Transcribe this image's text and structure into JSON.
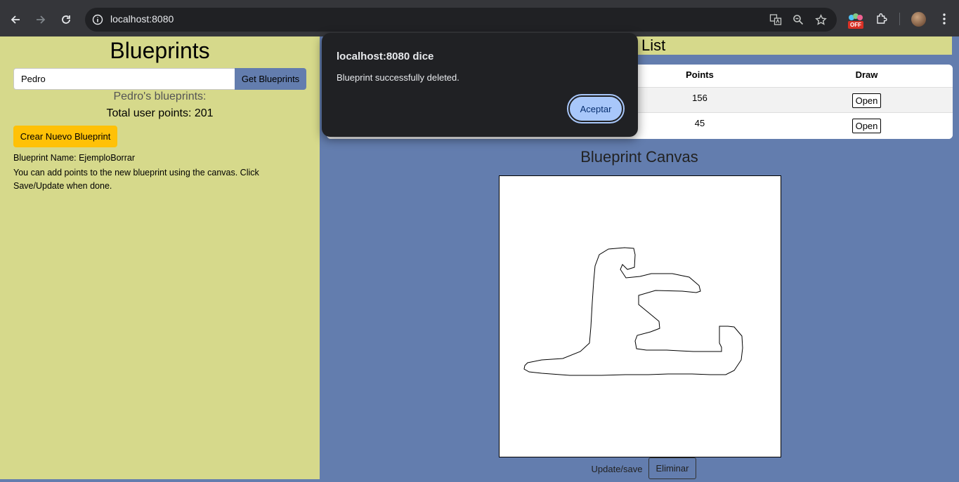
{
  "browser": {
    "url": "localhost:8080",
    "extension_badge": "OFF"
  },
  "sidebar": {
    "title": "Blueprints",
    "author_value": "Pedro",
    "get_button": "Get Blueprints",
    "user_blueprints": "Pedro's blueprints:",
    "total_points": "Total user points: 201",
    "create_button": "Crear Nuevo Blueprint",
    "blueprint_name": "Blueprint Name: EjemploBorrar",
    "help_text": "You can add points to the new blueprint using the canvas. Click Save/Update when done."
  },
  "list": {
    "header_partial": "ints List",
    "columns": {
      "points": "Points",
      "draw": "Draw"
    },
    "rows": [
      {
        "points": "156",
        "action": "Open"
      },
      {
        "points": "45",
        "action": "Open"
      }
    ]
  },
  "canvas": {
    "title": "Blueprint Canvas",
    "update_button": "Update/save",
    "delete_button": "Eliminar"
  },
  "dialog": {
    "title": "localhost:8080 dice",
    "message": "Blueprint successfully deleted.",
    "ok_button": "Aceptar"
  },
  "colors": {
    "sidebar_bg": "#d6d98b",
    "page_bg": "#637dae",
    "accent_yellow": "#ffc107",
    "dialog_bg": "#202124",
    "dialog_button": "#a8c7fa"
  }
}
